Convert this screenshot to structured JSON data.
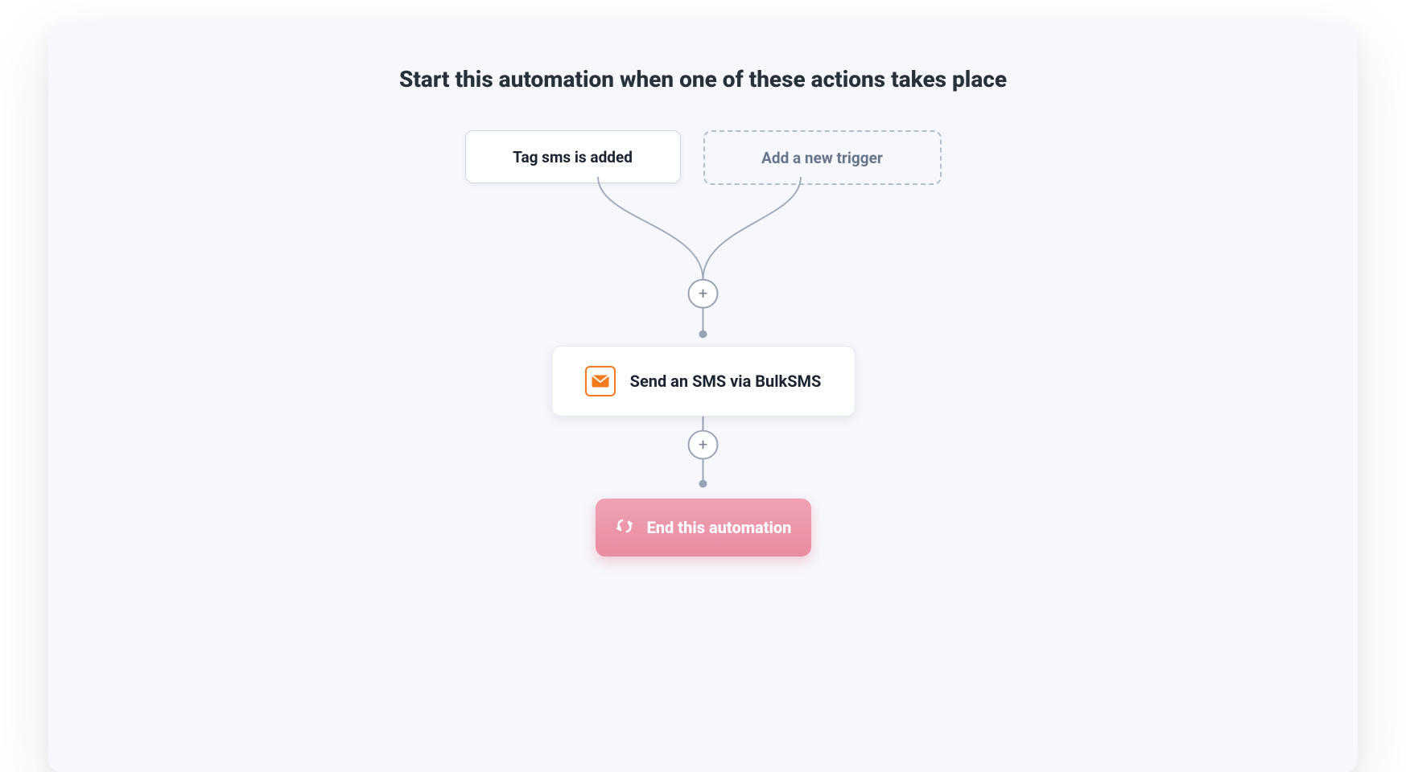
{
  "header": {
    "title": "Start this automation when one of these actions takes place"
  },
  "triggers": {
    "existing": [
      {
        "label": "Tag sms is added"
      }
    ],
    "add_label": "Add a new trigger"
  },
  "plus_buttons": {
    "top": "+",
    "bottom": "+"
  },
  "action": {
    "label": "Send an SMS via BulkSMS",
    "icon": "mail-icon"
  },
  "end": {
    "label": "End this automation"
  },
  "colors": {
    "connector": "#9aa3b6",
    "plus_border": "#9aa3b6",
    "plus_text": "#7a8396",
    "icon_orange": "#f47b1d",
    "end_pink_top": "#efa2b2",
    "end_pink_bottom": "#e98ca1"
  }
}
